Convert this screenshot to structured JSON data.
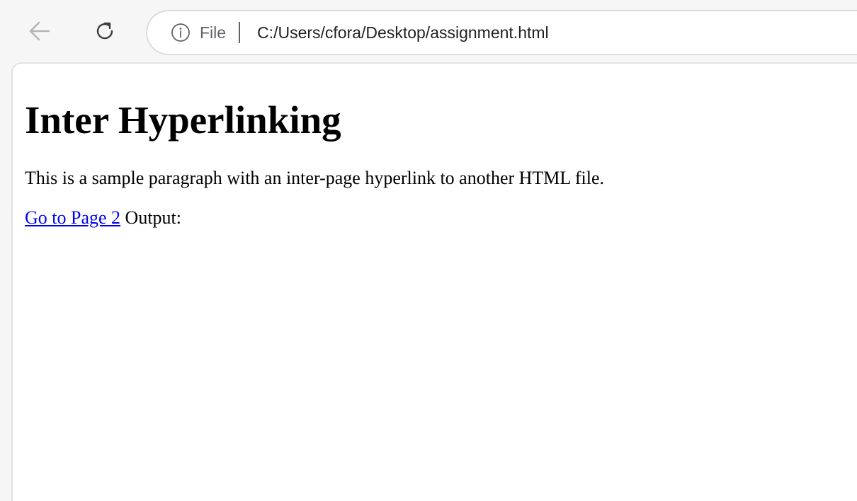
{
  "browser": {
    "back_icon": "arrow-left-icon",
    "reload_icon": "reload-icon",
    "address_bar": {
      "info_icon": "info-icon",
      "scheme_label": "File",
      "url": "C:/Users/cfora/Desktop/assignment.html"
    }
  },
  "page": {
    "heading": "Inter Hyperlinking",
    "paragraph": "This is a sample paragraph with an inter-page hyperlink to another HTML file.",
    "link_text": "Go to Page 2",
    "trailing_text": " Output:"
  },
  "colors": {
    "link": "#0000ee",
    "toolbar_bg": "#f6f6f6",
    "icon_gray": "#5f6368"
  }
}
